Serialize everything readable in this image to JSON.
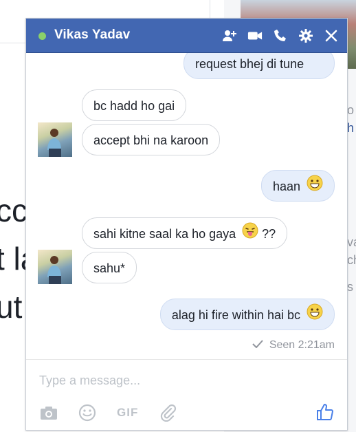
{
  "chat": {
    "title": "Vikas Yadav",
    "status": "online",
    "messages": [
      {
        "direction": "out",
        "text": "request bhej di tune"
      },
      {
        "direction": "in",
        "text": "bc hadd ho gai"
      },
      {
        "direction": "in",
        "text": "accept bhi na karoon"
      },
      {
        "direction": "out",
        "text": "haan",
        "emoji": "grin-emoji"
      },
      {
        "direction": "in",
        "text": "sahi kitne saal ka ho gaya",
        "emoji": "tongue-emoji",
        "suffix": "??"
      },
      {
        "direction": "in",
        "text": "sahu*"
      },
      {
        "direction": "out",
        "text": "alag hi fire within hai bc",
        "emoji": "grin-emoji"
      }
    ],
    "seen_label": "Seen 2:21am",
    "composer": {
      "placeholder": "Type a message...",
      "gif_label": "GIF"
    }
  },
  "background": {
    "fragments": [
      "cc",
      "t la",
      "ut",
      "o",
      "h",
      "va",
      "ch",
      "s"
    ]
  },
  "colors": {
    "titlebar": "#4267b2",
    "online": "#8ad06a",
    "outgoing_bubble": "#e6eefb",
    "like": "#4a80e8"
  }
}
